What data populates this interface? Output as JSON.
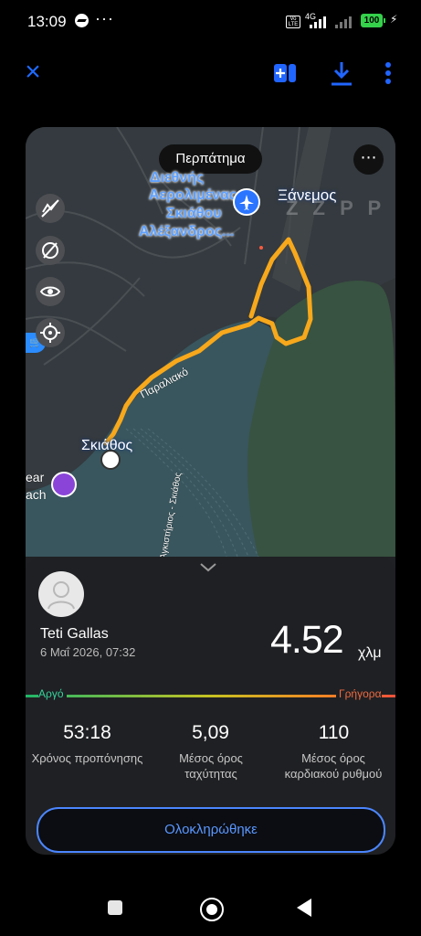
{
  "status_bar": {
    "time": "13:09",
    "more": "···",
    "network": "4G",
    "volte": "Vo LTE",
    "battery": "100",
    "icons": [
      "messenger-icon",
      "signal-icon",
      "battery-icon",
      "charging-icon"
    ]
  },
  "toolbar": {
    "close_icon": "×",
    "icons": [
      "close-icon",
      "add-to-route-icon",
      "download-icon",
      "more-vertical-icon"
    ],
    "accent_color": "#1f6bff"
  },
  "map": {
    "activity_type": "Περπάτημα",
    "airport_label": "Διεθνής Αερολιμένας Σκιάθου Αλέξανδρος...",
    "airport_lines": [
      "Διεθνής",
      "Αερολιμένας",
      "Σκιάθου",
      "Αλέξανδρος..."
    ],
    "place_label": "Ξάνεμος",
    "watermark": "Z Z P P",
    "road_label": "Παραλιακό",
    "town_label": "Σκιάθος",
    "ferry_label": "Αγκιστήριος - Σκιάθος",
    "partial_left_labels": [
      "ear",
      "ach"
    ],
    "control_icons": [
      "hide-heatmap-icon",
      "layers-off-icon",
      "visibility-icon",
      "location-target-icon"
    ],
    "route_color": "#f7a81b"
  },
  "summary": {
    "user_name": "Teti Gallas",
    "date": "6 Μαΐ 2026, 07:32",
    "distance_value": "4.52",
    "distance_unit": "χλμ",
    "pace_slow": "Αργό",
    "pace_fast": "Γρήγορα",
    "stats": [
      {
        "value": "53:18",
        "label": "Χρόνος προπόνησης"
      },
      {
        "value": "5,09",
        "label": "Μέσος όρος ταχύτητας"
      },
      {
        "value": "110",
        "label": "Μέσος όρος καρδιακού ρυθμού"
      }
    ],
    "complete_button": "Ολοκληρώθηκε"
  },
  "navigation": {
    "icons": [
      "recent-apps-icon",
      "home-icon",
      "back-icon"
    ]
  }
}
